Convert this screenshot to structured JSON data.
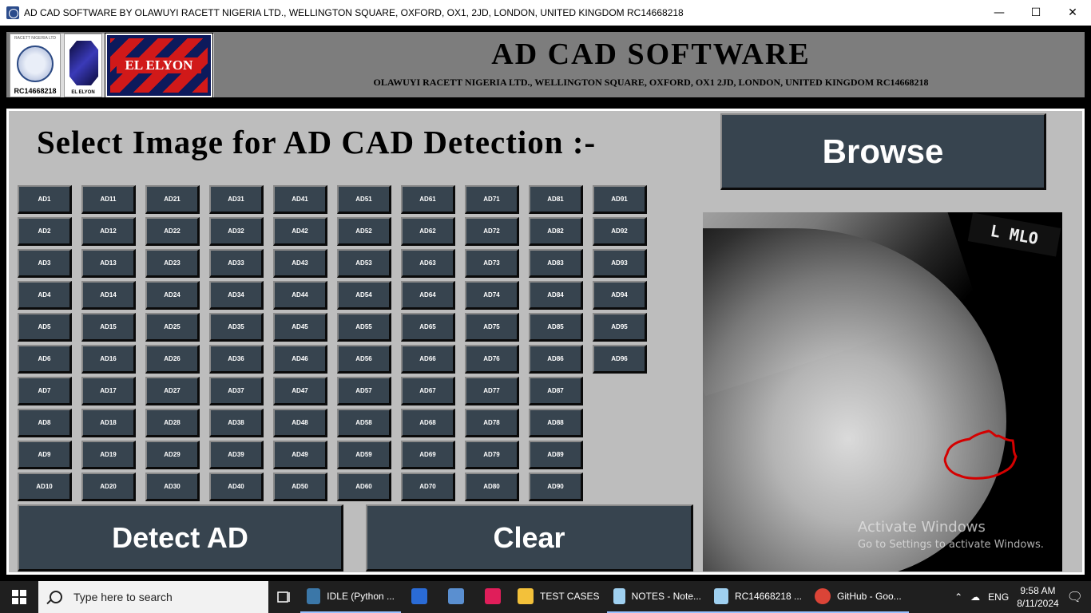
{
  "window": {
    "title": "AD CAD SOFTWARE BY OLAWUYI RACETT NIGERIA LTD., WELLINGTON SQUARE, OXFORD, OX1, 2JD, LONDON, UNITED KINGDOM RC14668218",
    "minimize": "—",
    "maximize": "☐",
    "close": "✕"
  },
  "header": {
    "app_name": "AD CAD SOFTWARE",
    "company": "OLAWUYI RACETT NIGERIA LTD., WELLINGTON SQUARE, OXFORD, OX1 2JD, LONDON, UNITED KINGDOM RC14668218",
    "logo1_top": "RACETT NIGERIA LTD",
    "logo1_tag": "RC14668218",
    "logo2_tag": "EL ELYON",
    "logo3_name": "EL ELYON"
  },
  "main": {
    "heading": "Select Image for AD CAD Detection :-",
    "browse_label": "Browse",
    "detect_label": "Detect AD",
    "clear_label": "Clear",
    "ad_columns": [
      [
        "AD1",
        "AD2",
        "AD3",
        "AD4",
        "AD5",
        "AD6",
        "AD7",
        "AD8",
        "AD9",
        "AD10"
      ],
      [
        "AD11",
        "AD12",
        "AD13",
        "AD14",
        "AD15",
        "AD16",
        "AD17",
        "AD18",
        "AD19",
        "AD20"
      ],
      [
        "AD21",
        "AD22",
        "AD23",
        "AD24",
        "AD25",
        "AD26",
        "AD27",
        "AD28",
        "AD29",
        "AD30"
      ],
      [
        "AD31",
        "AD32",
        "AD33",
        "AD34",
        "AD35",
        "AD36",
        "AD37",
        "AD38",
        "AD39",
        "AD40"
      ],
      [
        "AD41",
        "AD42",
        "AD43",
        "AD44",
        "AD45",
        "AD46",
        "AD47",
        "AD48",
        "AD49",
        "AD50"
      ],
      [
        "AD51",
        "AD52",
        "AD53",
        "AD54",
        "AD55",
        "AD56",
        "AD57",
        "AD58",
        "AD59",
        "AD60"
      ],
      [
        "AD61",
        "AD62",
        "AD63",
        "AD64",
        "AD65",
        "AD66",
        "AD67",
        "AD68",
        "AD69",
        "AD70"
      ],
      [
        "AD71",
        "AD72",
        "AD73",
        "AD74",
        "AD75",
        "AD76",
        "AD77",
        "AD78",
        "AD79",
        "AD80"
      ],
      [
        "AD81",
        "AD82",
        "AD83",
        "AD84",
        "AD85",
        "AD86",
        "AD87",
        "AD88",
        "AD89",
        "AD90"
      ],
      [
        "AD91",
        "AD92",
        "AD93",
        "AD94",
        "AD95",
        "AD96"
      ]
    ],
    "image": {
      "view_label": "L MLO",
      "watermark_title": "Activate Windows",
      "watermark_sub": "Go to Settings to activate Windows."
    }
  },
  "taskbar": {
    "search_placeholder": "Type here to search",
    "apps": [
      {
        "label": "IDLE (Python ...",
        "icon": "python-icon",
        "active": true
      },
      {
        "label": "",
        "icon": "store-icon",
        "active": false
      },
      {
        "label": "",
        "icon": "network-icon",
        "active": false
      },
      {
        "label": "",
        "icon": "slack-icon",
        "active": false
      },
      {
        "label": "TEST CASES",
        "icon": "folder-icon",
        "active": false
      },
      {
        "label": "NOTES - Note...",
        "icon": "notepad-icon",
        "active": true
      },
      {
        "label": "RC14668218 ...",
        "icon": "notepad-icon",
        "active": true
      },
      {
        "label": "GitHub - Goo...",
        "icon": "chrome-icon",
        "active": true
      }
    ],
    "language": "ENG",
    "time": "9:58 AM",
    "date": "8/11/2024"
  },
  "colors": {
    "button_bg": "#37444f",
    "panel_bg": "#bdbdbd",
    "header_bg": "#7d7d7d",
    "lesion_outline": "#d40000"
  }
}
